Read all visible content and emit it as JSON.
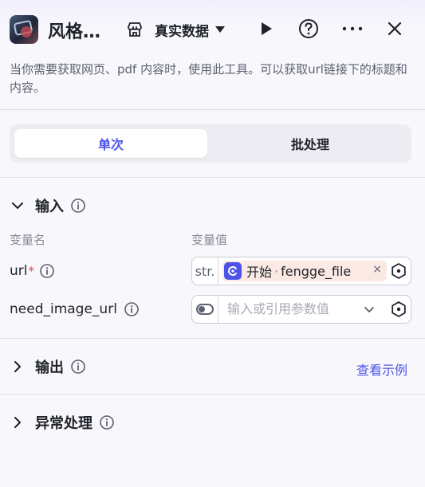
{
  "header": {
    "title": "风格…",
    "mode_label": "真实数据",
    "icons": [
      "app-logo",
      "store-icon",
      "caret-down-icon",
      "play-icon",
      "help-icon",
      "more-icon",
      "close-icon"
    ]
  },
  "description": "当你需要获取网页、pdf 内容时，使用此工具。可以获取url链接下的标题和内容。",
  "tabs": [
    {
      "label": "单次",
      "selected": true
    },
    {
      "label": "批处理",
      "selected": false
    }
  ],
  "input_section": {
    "title": "输入",
    "col_name": "变量名",
    "col_value": "变量值",
    "params": [
      {
        "name": "url",
        "required_mark": "*",
        "type_tag": "str.",
        "ref_source": "开始",
        "ref_sep": "·",
        "ref_var": "fengge_file",
        "remove": "×"
      },
      {
        "name": "need_image_url",
        "placeholder": "输入或引用参数值"
      }
    ]
  },
  "output_section": {
    "title": "输出",
    "link": "查看示例"
  },
  "exception_section": {
    "title": "异常处理"
  },
  "colors": {
    "accent": "#4d53e8",
    "required": "#e0434b",
    "chip_bg": "#fbe9e4"
  }
}
